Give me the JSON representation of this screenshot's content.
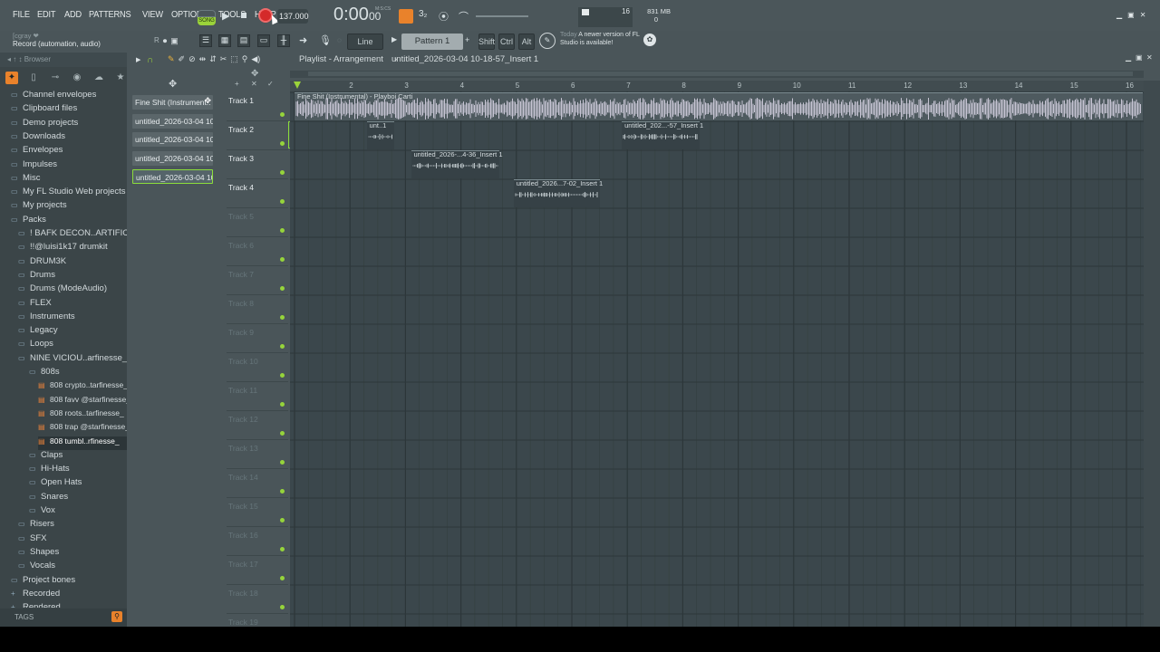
{
  "menu": [
    "FILE",
    "EDIT",
    "ADD",
    "PATTERNS",
    "VIEW",
    "OPTIONS",
    "TOOLS",
    "HELP"
  ],
  "transport": {
    "mode": "SONG",
    "tempo": "137.000",
    "time_main": "0:00",
    "time_sub": "00",
    "time_unit": "M:S:CS",
    "cpu": "16",
    "mem": "831 MB",
    "mem_sub": "0"
  },
  "hint": {
    "user": "[cgray ❤",
    "text": "Record (automation, audio)"
  },
  "toolbar": {
    "snap": "Line",
    "pattern": "Pattern 1",
    "keys": [
      "Shift",
      "Ctrl",
      "Alt"
    ],
    "news_day": "Today",
    "news_text": "A newer version of FL Studio is available!"
  },
  "browser": {
    "title": "Browser",
    "tags_label": "TAGS",
    "items": [
      {
        "label": "Channel envelopes",
        "indent": 0,
        "kind": "folder"
      },
      {
        "label": "Clipboard files",
        "indent": 0,
        "kind": "folder"
      },
      {
        "label": "Demo projects",
        "indent": 0,
        "kind": "folder"
      },
      {
        "label": "Downloads",
        "indent": 0,
        "kind": "folder"
      },
      {
        "label": "Envelopes",
        "indent": 0,
        "kind": "folder"
      },
      {
        "label": "Impulses",
        "indent": 0,
        "kind": "folder"
      },
      {
        "label": "Misc",
        "indent": 0,
        "kind": "folder"
      },
      {
        "label": "My FL Studio Web projects",
        "indent": 0,
        "kind": "folder"
      },
      {
        "label": "My projects",
        "indent": 0,
        "kind": "folder"
      },
      {
        "label": "Packs",
        "indent": 0,
        "kind": "open"
      },
      {
        "label": "! BAFK DECON..ARTIFICIAL",
        "indent": 1,
        "kind": "folder"
      },
      {
        "label": "!!@luisi1k17 drumkit",
        "indent": 1,
        "kind": "folder"
      },
      {
        "label": "DRUM3K",
        "indent": 1,
        "kind": "folder"
      },
      {
        "label": "Drums",
        "indent": 1,
        "kind": "folder"
      },
      {
        "label": "Drums (ModeAudio)",
        "indent": 1,
        "kind": "folder"
      },
      {
        "label": "FLEX",
        "indent": 1,
        "kind": "folder"
      },
      {
        "label": "Instruments",
        "indent": 1,
        "kind": "folder"
      },
      {
        "label": "Legacy",
        "indent": 1,
        "kind": "folder"
      },
      {
        "label": "Loops",
        "indent": 1,
        "kind": "folder"
      },
      {
        "label": "NINE VICIOU..arfinesse_",
        "indent": 1,
        "kind": "open"
      },
      {
        "label": "808s",
        "indent": 2,
        "kind": "open"
      },
      {
        "label": "808 crypto..tarfinesse_",
        "indent": 3,
        "kind": "wav"
      },
      {
        "label": "808 favv @starfinesse_",
        "indent": 3,
        "kind": "wav"
      },
      {
        "label": "808 roots..tarfinesse_",
        "indent": 3,
        "kind": "wav"
      },
      {
        "label": "808 trap @starfinesse_",
        "indent": 3,
        "kind": "wav"
      },
      {
        "label": "808 tumbl..rfinesse_",
        "indent": 3,
        "kind": "wav-sel"
      },
      {
        "label": "Claps",
        "indent": 2,
        "kind": "folder"
      },
      {
        "label": "Hi-Hats",
        "indent": 2,
        "kind": "folder"
      },
      {
        "label": "Open Hats",
        "indent": 2,
        "kind": "folder"
      },
      {
        "label": "Snares",
        "indent": 2,
        "kind": "folder"
      },
      {
        "label": "Vox",
        "indent": 2,
        "kind": "folder"
      },
      {
        "label": "Risers",
        "indent": 1,
        "kind": "folder"
      },
      {
        "label": "SFX",
        "indent": 1,
        "kind": "folder"
      },
      {
        "label": "Shapes",
        "indent": 1,
        "kind": "folder"
      },
      {
        "label": "Vocals",
        "indent": 1,
        "kind": "folder"
      },
      {
        "label": "Project bones",
        "indent": 0,
        "kind": "folder"
      },
      {
        "label": "Recorded",
        "indent": 0,
        "kind": "plus"
      },
      {
        "label": "Rendered",
        "indent": 0,
        "kind": "plus"
      }
    ]
  },
  "picker": [
    "Fine Shit (Instrument..",
    "untitled_2026-03-04 10-..",
    "untitled_2026-03-04 10-..",
    "untitled_2026-03-04 10-..",
    "untitled_2026-03-04 10-.."
  ],
  "playlist": {
    "title": "Playlist - Arrangement",
    "separator": "›",
    "item": "untitled_2026-03-04 10-18-57_Insert 1",
    "ruler": [
      "2",
      "3",
      "4",
      "5",
      "6",
      "7",
      "8",
      "9",
      "10",
      "11",
      "12",
      "13",
      "14",
      "15",
      "16"
    ],
    "tracks": [
      "Track 1",
      "Track 2",
      "Track 3",
      "Track 4",
      "Track 5",
      "Track 6",
      "Track 7",
      "Track 8",
      "Track 9",
      "Track 10",
      "Track 11",
      "Track 12",
      "Track 13",
      "Track 14",
      "Track 15",
      "Track 16",
      "Track 17",
      "Track 18",
      "Track 19"
    ],
    "clips": [
      {
        "label": "Fine Shit (Instrumental) - Playboi Carti",
        "track": 1,
        "start_bar": 1.0,
        "end_bar": 16.3
      },
      {
        "label": "unt..1",
        "track": 2,
        "start_bar": 2.3,
        "end_bar": 2.8
      },
      {
        "label": "untitled_202...-57_Insert 1",
        "track": 2,
        "start_bar": 6.9,
        "end_bar": 8.3
      },
      {
        "label": "untitled_2026-...4-36_Insert 1",
        "track": 3,
        "start_bar": 3.1,
        "end_bar": 4.7
      },
      {
        "label": "untitled_2026...7-02_Insert 1",
        "track": 4,
        "start_bar": 4.95,
        "end_bar": 6.5
      }
    ]
  },
  "colors": {
    "accent_orange": "#e9822b",
    "record_red": "#d42a2a",
    "selection_green": "#8bdc3b",
    "track_dot": "#96d43b"
  }
}
